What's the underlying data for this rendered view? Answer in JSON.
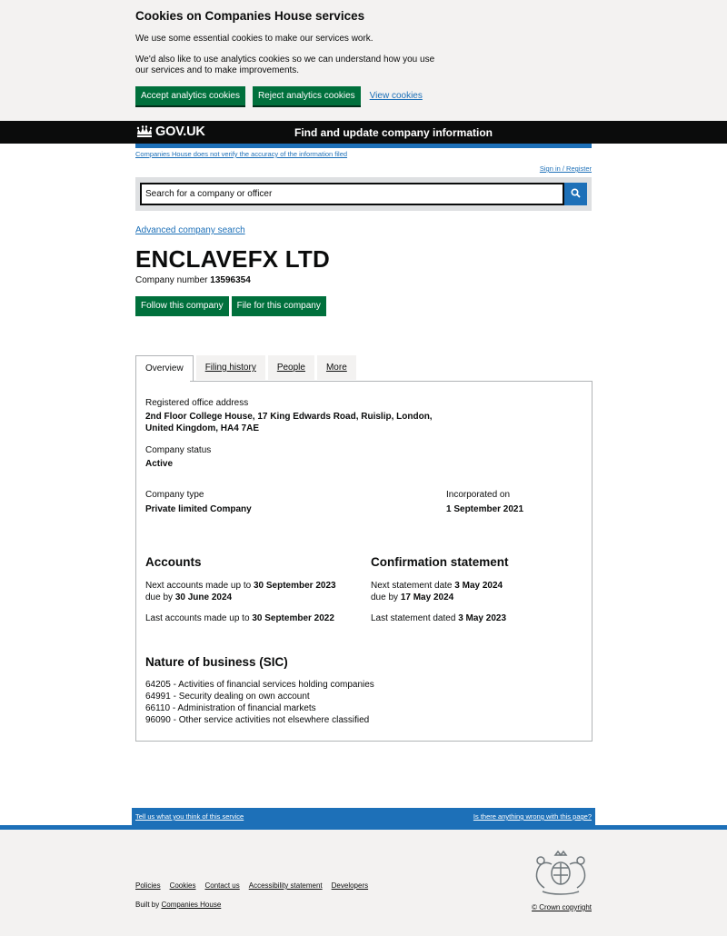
{
  "cookie_banner": {
    "title": "Cookies on Companies House services",
    "p1": "We use some essential cookies to make our services work.",
    "p2": "We'd also like to use analytics cookies so we can understand how you use our services and to make improvements.",
    "accept_label": "Accept analytics cookies",
    "reject_label": "Reject analytics cookies",
    "view_label": "View cookies"
  },
  "header": {
    "logo_text": "GOV.UK",
    "service_name": "Find and update company information"
  },
  "notices": {
    "verify_text": "Companies House does not verify the accuracy of the information filed",
    "signin_text": "Sign in / Register"
  },
  "search": {
    "placeholder": "Search for a company or officer",
    "button_icon": "search-icon",
    "advanced_link": "Advanced company search"
  },
  "company": {
    "name": "ENCLAVEFX LTD",
    "number_label": "Company number",
    "number": "13596354",
    "follow_label": "Follow this company",
    "file_label": "File for this company"
  },
  "tabs": [
    {
      "label": "Overview"
    },
    {
      "label": "Filing history"
    },
    {
      "label": "People"
    },
    {
      "label": "More"
    }
  ],
  "overview": {
    "registered_office_label": "Registered office address",
    "registered_office_line1": "2nd Floor College House, 17 King Edwards Road, Ruislip, London,",
    "registered_office_line2": "United Kingdom, HA4 7AE",
    "status_label": "Company status",
    "status_value": "Active",
    "type_label": "Company type",
    "type_value": "Private limited Company",
    "incorporated_label": "Incorporated on",
    "incorporated_value": "1 September 2021",
    "accounts": {
      "heading": "Accounts",
      "next_prefix": "Next accounts made up to",
      "next_date": "30 September 2023",
      "due_prefix": "due by",
      "due_date": "30 June 2024",
      "last_prefix": "Last accounts made up to",
      "last_date": "30 September 2022"
    },
    "confirmation": {
      "heading": "Confirmation statement",
      "next_prefix": "Next statement date",
      "next_date": "3 May 2024",
      "due_prefix": "due by",
      "due_date": "17 May 2024",
      "last_prefix": "Last statement dated",
      "last_date": "3 May 2023"
    },
    "sic": {
      "heading": "Nature of business (SIC)",
      "items": [
        "64205 - Activities of financial services holding companies",
        "64991 - Security dealing on own account",
        "66110 - Administration of financial markets",
        "96090 - Other service activities not elsewhere classified"
      ]
    }
  },
  "feedback": {
    "left_link": "Tell us what you think of this service",
    "right_link": "Is there anything wrong with this page?"
  },
  "footer": {
    "links": [
      "Policies",
      "Cookies",
      "Contact us",
      "Accessibility statement",
      "Developers"
    ],
    "built_prefix": "Built by",
    "built_link": "Companies House",
    "copyright": "© Crown copyright"
  },
  "colors": {
    "green": "#00703c",
    "blue": "#1d70b8",
    "black": "#0b0c0c",
    "grey_bg": "#f3f2f1"
  }
}
